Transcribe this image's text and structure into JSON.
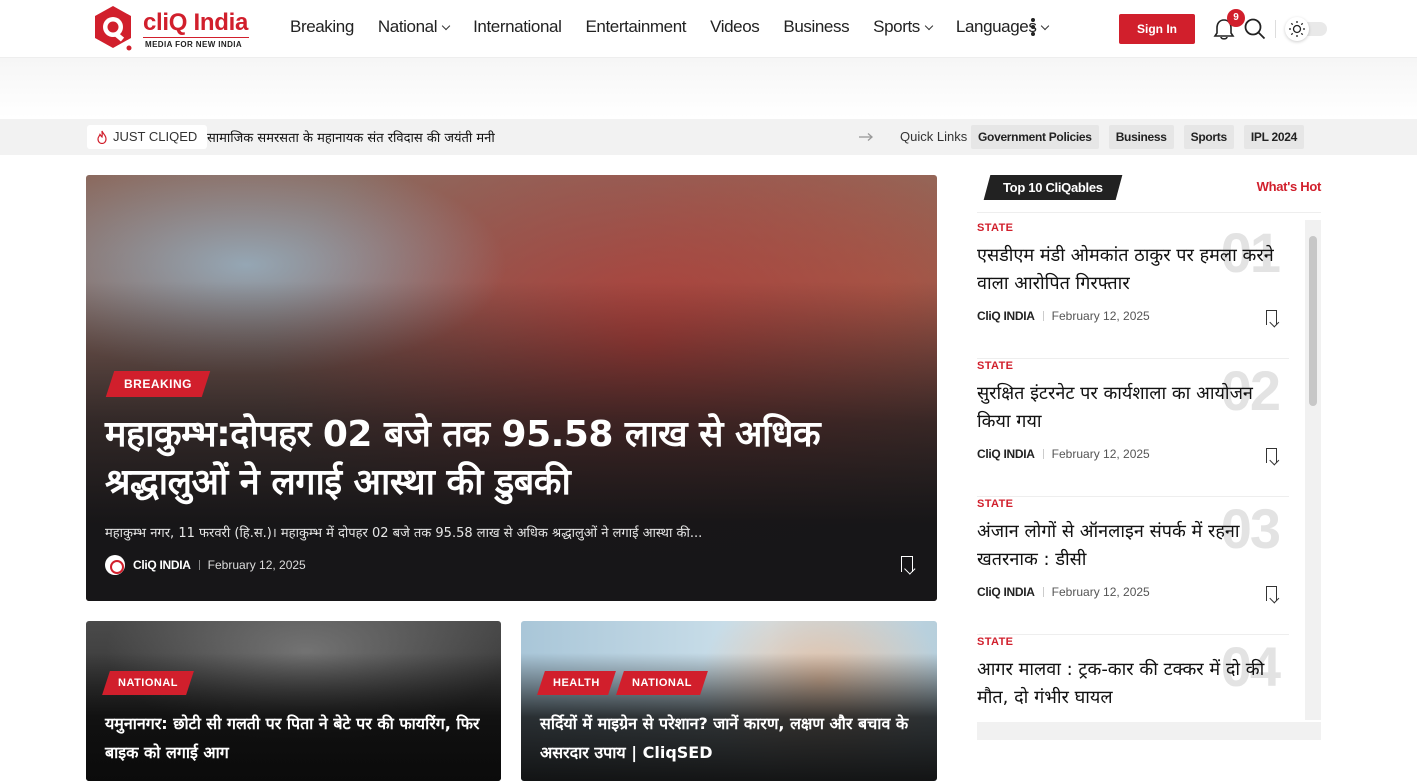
{
  "brand": {
    "name": "cliQ India",
    "tagline": "MEDIA FOR NEW INDIA",
    "color": "#d11f2c"
  },
  "nav": {
    "items": [
      {
        "label": "Breaking",
        "dropdown": false
      },
      {
        "label": "National",
        "dropdown": true
      },
      {
        "label": "International",
        "dropdown": false
      },
      {
        "label": "Entertainment",
        "dropdown": false
      },
      {
        "label": "Videos",
        "dropdown": false
      },
      {
        "label": "Business",
        "dropdown": false
      },
      {
        "label": "Sports",
        "dropdown": true
      },
      {
        "label": "Languages",
        "dropdown": true
      }
    ],
    "more_icon": "kebab-menu-icon",
    "signin_label": "Sign In",
    "notification_count": "9",
    "notification_icon": "bell-icon",
    "search_icon": "search-icon",
    "mode_icon": "sun-icon"
  },
  "ticker": {
    "label": "JUST CLIQED",
    "headline": "सामाजिक समरसता के महानायक संत रविदास की जयंती मनी",
    "quick_links_label": "Quick Links",
    "quick_links": [
      "Government Policies",
      "Business",
      "Sports",
      "IPL 2024"
    ]
  },
  "hero": {
    "category": "BREAKING",
    "title": "महाकुम्भ:दोपहर 02 बजे तक 95.58 लाख से अधिक श्रद्धालुओं ने लगाई आस्था की डुबकी",
    "excerpt": "महाकुम्भ नगर, 11 फरवरी (हि.स.)। महाकुम्भ में दोपहर 02 बजे तक 95.58 लाख से अधिक श्रद्धालुओं ने लगाई आस्था की...",
    "author": "CliQ INDIA",
    "date": "February 12, 2025"
  },
  "cards": [
    {
      "tags": [
        "NATIONAL"
      ],
      "title": "यमुनानगर: छोटी सी गलती पर पिता ने बेटे पर की फायरिंग, फिर बाइक को लगाई आग"
    },
    {
      "tags": [
        "HEALTH",
        "NATIONAL"
      ],
      "title": "सर्दियों में माइग्रेन से परेशान? जानें कारण, लक्षण और बचाव के असरदार उपाय | CliqSED"
    }
  ],
  "sidebar": {
    "heading": "Top 10 CliQables",
    "hot_label": "What's Hot",
    "items": [
      {
        "category": "STATE",
        "number": "01",
        "title": "एसडीएम मंडी ओमकांत ठाकुर पर हमला करने वाला आरोपित गिरफ्तार",
        "author": "CliQ INDIA",
        "date": "February 12, 2025"
      },
      {
        "category": "STATE",
        "number": "02",
        "title": "सुरक्षित इंटरनेट पर कार्यशाला का आयोजन किया  गया",
        "author": "CliQ INDIA",
        "date": "February 12, 2025"
      },
      {
        "category": "STATE",
        "number": "03",
        "title": "अंजान लोगों से ऑनलाइन संपर्क में रहना खतरनाक : डीसी",
        "author": "CliQ INDIA",
        "date": "February 12, 2025"
      },
      {
        "category": "STATE",
        "number": "04",
        "title": "आगर मालवा  : ट्रक-कार की टक्कर में दो की मौत, दो गंभीर घायल",
        "author": "",
        "date": ""
      }
    ]
  }
}
